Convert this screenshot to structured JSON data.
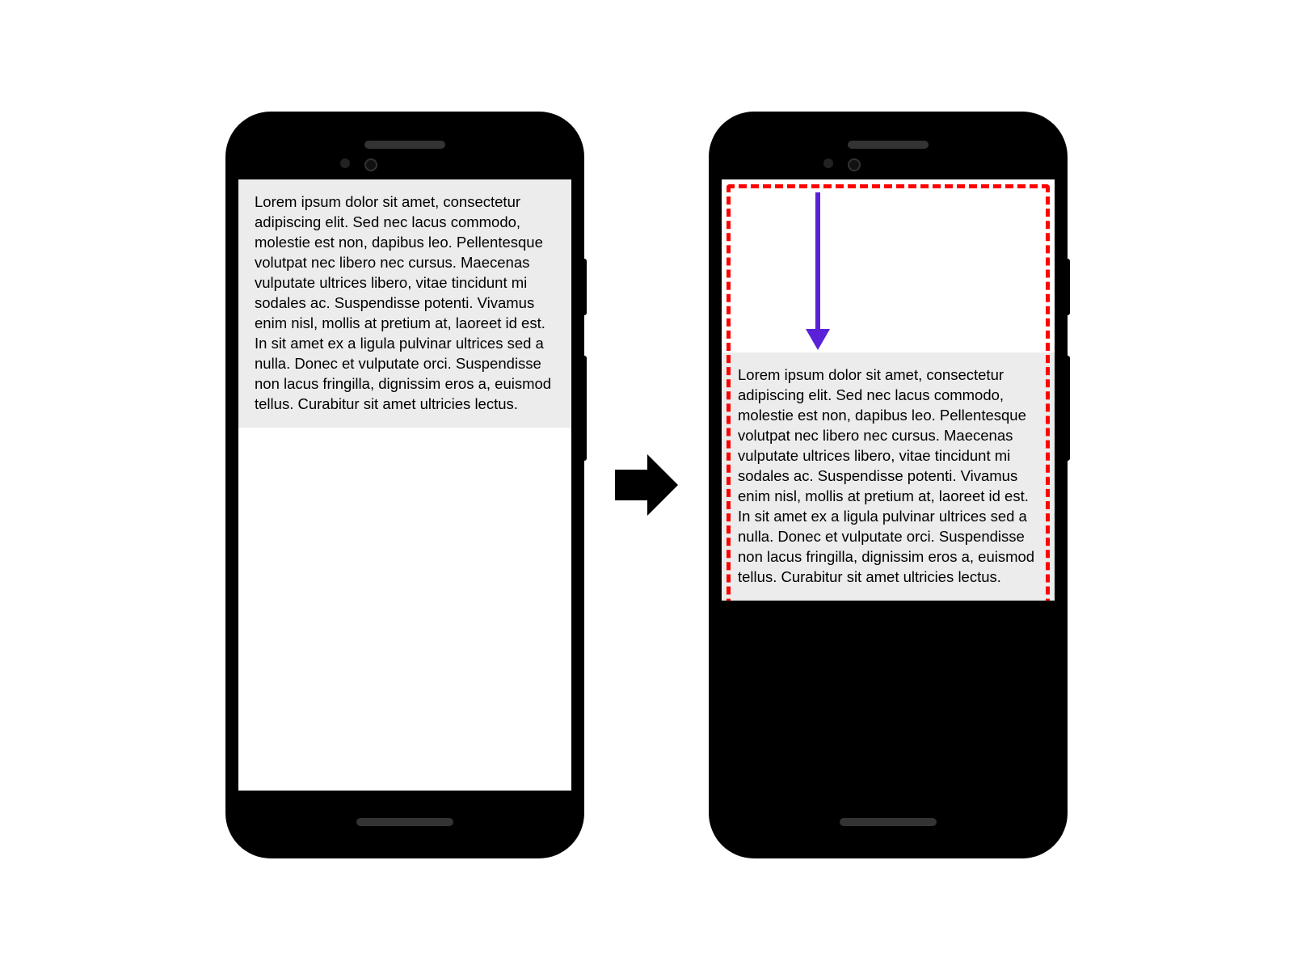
{
  "diagram": {
    "left_phone": {
      "text_content": "Lorem ipsum dolor sit amet, consectetur adipiscing elit. Sed nec lacus commodo, molestie est non, dapibus leo. Pellentesque volutpat nec libero nec cursus. Maecenas vulputate ultrices libero, vitae tincidunt mi sodales ac. Suspendisse potenti. Vivamus enim nisl, mollis at pretium at, laoreet id est. In sit amet ex a ligula pulvinar ultrices sed a nulla. Donec et vulputate orci. Suspendisse non lacus fringilla, dignissim eros a, euismod tellus. Curabitur sit amet ultricies lectus."
    },
    "right_phone": {
      "text_content": "Lorem ipsum dolor sit amet, consectetur adipiscing elit. Sed nec lacus commodo, molestie est non, dapibus leo. Pellentesque volutpat nec libero nec cursus. Maecenas vulputate ultrices libero, vitae tincidunt mi sodales ac. Suspendisse potenti. Vivamus enim nisl, mollis at pretium at, laoreet id est. In sit amet ex a ligula pulvinar ultrices sed a nulla. Donec et vulputate orci. Suspendisse non lacus fringilla, dignissim eros a, euismod tellus. Curabitur sit amet ultricies lectus."
    },
    "annotations": {
      "highlight_color": "#ff0000",
      "arrow_color": "#5b21d6",
      "transition_arrow_color": "#000000"
    }
  }
}
